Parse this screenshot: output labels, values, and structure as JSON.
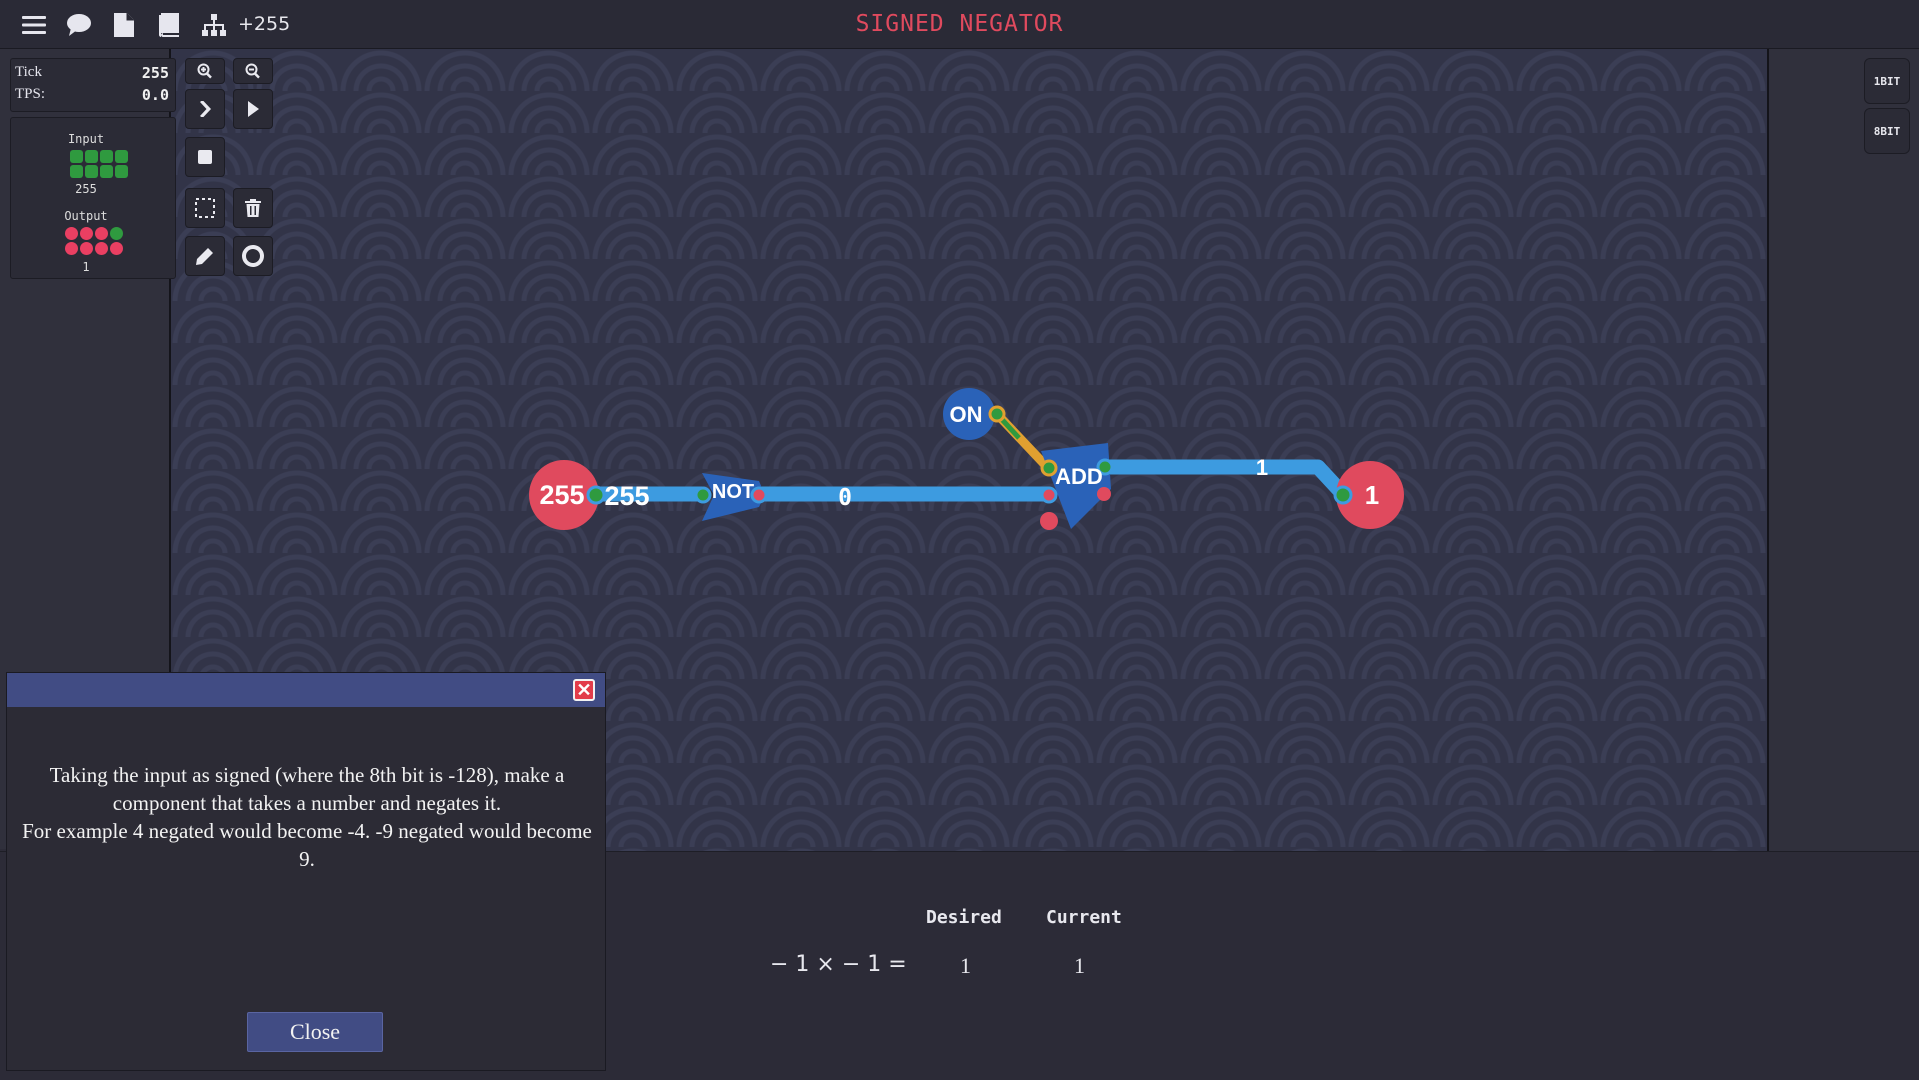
{
  "topbar": {
    "menu_icon": "hamburger-menu-icon",
    "chat_icon": "speech-bubble-icon",
    "file_icon": "document-icon",
    "book_icon": "book-icon",
    "hierarchy_icon": "hierarchy-icon",
    "count": "+255",
    "title": "SIGNED NEGATOR",
    "title_color": "#e04a5e"
  },
  "stats": {
    "tick_label": "Tick",
    "tick_value": "255",
    "tps_label": "TPS:",
    "tps_value": "0.0"
  },
  "io": {
    "input_label": "Input",
    "input_value": "255",
    "input_bits": [
      "g",
      "g",
      "g",
      "g",
      "g",
      "g",
      "g",
      "g"
    ],
    "output_label": "Output",
    "output_value": "1",
    "output_bits": [
      "r",
      "r",
      "r",
      "g",
      "r",
      "r",
      "r",
      "r"
    ]
  },
  "tools": {
    "zoom_in": "zoom-in-icon",
    "zoom_out": "zoom-out-icon",
    "step": "step-forward-icon",
    "play": "play-icon",
    "stop": "stop-icon",
    "select": "selection-box-icon",
    "delete": "trash-icon",
    "pencil": "pencil-icon",
    "ring": "ring-icon"
  },
  "bit_modes": [
    "1BIT",
    "8BIT"
  ],
  "circuit": {
    "input_node": "255",
    "wire_label_1": "255",
    "not_label": "NOT",
    "wire_label_2": "0",
    "on_label": "ON",
    "add_label": "ADD",
    "wire_label_3": "1",
    "output_node": "1",
    "wire_color": "#3d9be0",
    "on_wire_color": "#e0a030",
    "node_color": "#e04a5e",
    "gate_color": "#2a62b8"
  },
  "results": {
    "desired_label": "Desired",
    "current_label": "Current",
    "equation": "− 1 × − 1 =",
    "desired_value": "1",
    "current_value": "1"
  },
  "dialog": {
    "close_x": "✕",
    "line1": "Taking the input as signed (where the 8th bit is -128), make a component that takes a number and negates it.",
    "line2": "For example 4 negated would become -4. -9 negated would become 9.",
    "close_label": "Close"
  }
}
